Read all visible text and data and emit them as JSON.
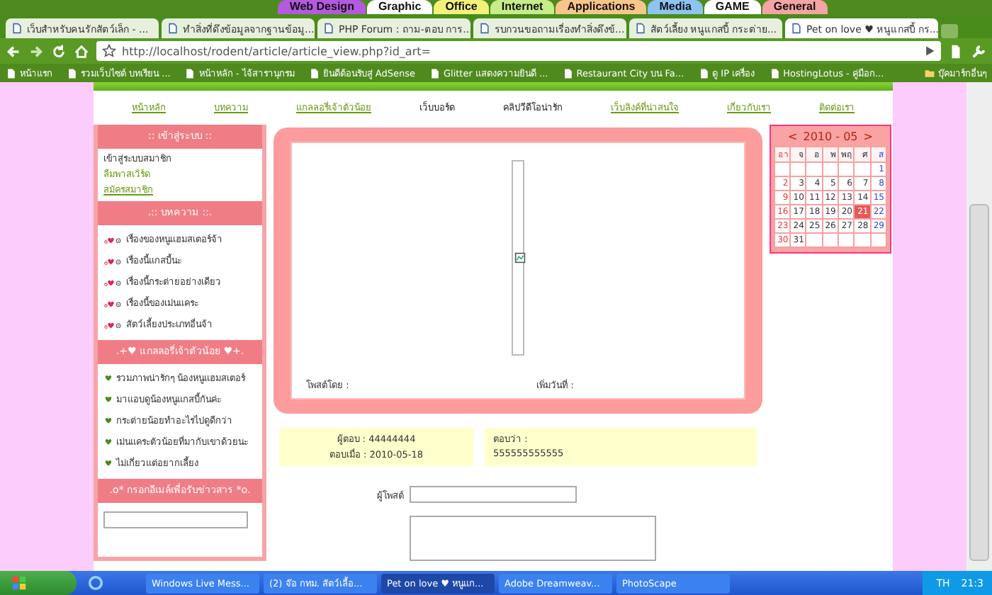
{
  "top_categories": [
    {
      "label": "Web Design",
      "color": "#b55ae0"
    },
    {
      "label": "Graphic",
      "color": "#ffffff"
    },
    {
      "label": "Office",
      "color": "#f2f27a"
    },
    {
      "label": "Internet",
      "color": "#c8ec8a"
    },
    {
      "label": "Applications",
      "color": "#f8c68a"
    },
    {
      "label": "Media",
      "color": "#8cc4f2"
    },
    {
      "label": "GAME",
      "color": "#ffffff"
    },
    {
      "label": "General",
      "color": "#f4a4a4"
    }
  ],
  "browser": {
    "tabs": [
      {
        "title": "เว็บสำหรับคนรักสัตว์เล็ก - ...",
        "selected": false
      },
      {
        "title": "ทำสิ่งที่ดึงข้อมูลจากฐานข้อมู...",
        "selected": false
      },
      {
        "title": "PHP Forum : ถาม-ตอบ การ...",
        "selected": false
      },
      {
        "title": "รบกวนขอถามเรื่องทำสิ่งดึงข้...",
        "selected": false
      },
      {
        "title": "สัตว์เลี้ยง หนูแกสบี้ กระต่าย...",
        "selected": false
      },
      {
        "title": "Pet on love ♥ หนูแกสบี้ กร...",
        "selected": true
      }
    ],
    "address": "http://localhost/rodent/article/article_view.php?id_art=",
    "bookmarks": [
      "หน้าแรก",
      "รวมเว็บไซต์ บทเรียน ...",
      "หน้าหลัก - ไจ้สารานุกรม",
      "ยินดีต้อนรับสู่ AdSense",
      "Glitter แสดงความยินดี ...",
      "Restaurant City บน Fa...",
      "ดู IP เครื่อง",
      "HostingLotus - คู่มือก..."
    ],
    "other_bookmarks": "บุ๊คมาร์กอื่นๆ"
  },
  "nav": [
    {
      "label": "หน้าหลัก",
      "underlined": true
    },
    {
      "label": "บทความ",
      "underlined": true
    },
    {
      "label": "แกลลอรี่เจ้าตัวน้อย",
      "underlined": true
    },
    {
      "label": "เว็บบอร์ด",
      "underlined": false
    },
    {
      "label": "คลิปวีดีโอน่ารัก",
      "underlined": false
    },
    {
      "label": "เว็บลิงค์ที่น่าสนใจ",
      "underlined": true
    },
    {
      "label": "เกี่ยวกับเรา",
      "underlined": true
    },
    {
      "label": "ติดต่อเรา",
      "underlined": true
    }
  ],
  "sidebar": [
    {
      "title": ":: เข้าสู่ระบบ ::",
      "kind": "login",
      "items": [
        {
          "label": "เข้าสู่ระบบสมาชิก",
          "kind": "text"
        },
        {
          "label": "ลืมพาสเวิร์ด",
          "kind": "link"
        },
        {
          "label": "สมัครสมาชิก",
          "kind": "underlined"
        }
      ]
    },
    {
      "title": ".:: บทความ ::.",
      "kind": "articles",
      "items": [
        {
          "label": "เรื่องของหนูแฮมสเตอร์จ้า",
          "kind": "text"
        },
        {
          "label": "เรื่องนี้แกสบี้นะ",
          "kind": "text"
        },
        {
          "label": "เรื่องนี้กระต่ายอย่างเดียว",
          "kind": "text"
        },
        {
          "label": "เรื่องนี้ของเม่นแคระ",
          "kind": "text"
        },
        {
          "label": "สัตว์เลี้ยงประเภทอื่นจ้า",
          "kind": "text"
        }
      ]
    },
    {
      "title": ".+♥ แกลลอรี่เจ้าตัวน้อย ♥+.",
      "kind": "gallery",
      "items": [
        {
          "label": "รวมภาพน่ารักๆ น้องหนูแฮมสเตอร์",
          "kind": "text"
        },
        {
          "label": "มาแอบดูน้องหนูแกสบี้กันค่ะ",
          "kind": "text"
        },
        {
          "label": "กระต่ายน้อยทำอะไรไปดูดีกว่า",
          "kind": "text"
        },
        {
          "label": "เม่นแคระตัวน้อยที่มากับเขาด้วยนะ",
          "kind": "text"
        },
        {
          "label": "ไม่เกี่ยวแต่อยากเลี้ยง",
          "kind": "text"
        }
      ]
    },
    {
      "title": ".o* กรอกอีเมล์เพื่อรับข่าวสาร *o.",
      "kind": "email"
    }
  ],
  "post": {
    "by_label": "โพสต์โดย :",
    "date_label": "เพิ่มวันที่ :"
  },
  "reply": {
    "author": "ผู้ตอบ : 44444444",
    "replied_at": "ตอบเมื่อ : 2010-05-18",
    "message_label": "ตอบว่า :",
    "message": "555555555555"
  },
  "form": {
    "poster_label": "ผู้โพสต์"
  },
  "calendar": {
    "prev": "<",
    "title": "2010 - 05",
    "next": ">",
    "weekdays": [
      {
        "label": "อา",
        "color": "#e03a3a"
      },
      {
        "label": "จ",
        "color": "#333333"
      },
      {
        "label": "อ",
        "color": "#333333"
      },
      {
        "label": "พ",
        "color": "#333333"
      },
      {
        "label": "พฤ",
        "color": "#333333"
      },
      {
        "label": "ศ",
        "color": "#333333"
      },
      {
        "label": "ส",
        "color": "#3344cc"
      }
    ],
    "weeks": [
      [
        {
          "kind": "blank"
        },
        {
          "kind": "blank"
        },
        {
          "kind": "blank"
        },
        {
          "kind": "blank"
        },
        {
          "kind": "blank"
        },
        {
          "kind": "blank"
        },
        {
          "kind": "day",
          "day": "1",
          "selected": false
        }
      ],
      [
        {
          "kind": "day",
          "day": "2",
          "selected": false
        },
        {
          "kind": "day",
          "day": "3",
          "selected": false
        },
        {
          "kind": "day",
          "day": "4",
          "selected": false
        },
        {
          "kind": "day",
          "day": "5",
          "selected": false
        },
        {
          "kind": "day",
          "day": "6",
          "selected": false
        },
        {
          "kind": "day",
          "day": "7",
          "selected": false
        },
        {
          "kind": "day",
          "day": "8",
          "selected": false
        }
      ],
      [
        {
          "kind": "day",
          "day": "9",
          "selected": false
        },
        {
          "kind": "day",
          "day": "10",
          "selected": false
        },
        {
          "kind": "day",
          "day": "11",
          "selected": false
        },
        {
          "kind": "day",
          "day": "12",
          "selected": false
        },
        {
          "kind": "day",
          "day": "13",
          "selected": false
        },
        {
          "kind": "day",
          "day": "14",
          "selected": false
        },
        {
          "kind": "day",
          "day": "15",
          "selected": false
        }
      ],
      [
        {
          "kind": "day",
          "day": "16",
          "selected": false
        },
        {
          "kind": "day",
          "day": "17",
          "selected": false
        },
        {
          "kind": "day",
          "day": "18",
          "selected": false
        },
        {
          "kind": "day",
          "day": "19",
          "selected": false
        },
        {
          "kind": "day",
          "day": "20",
          "selected": false
        },
        {
          "kind": "day",
          "day": "21",
          "selected": true
        },
        {
          "kind": "day",
          "day": "22",
          "selected": false
        }
      ],
      [
        {
          "kind": "day",
          "day": "23",
          "selected": false
        },
        {
          "kind": "day",
          "day": "24",
          "selected": false
        },
        {
          "kind": "day",
          "day": "25",
          "selected": false
        },
        {
          "kind": "day",
          "day": "26",
          "selected": false
        },
        {
          "kind": "day",
          "day": "27",
          "selected": false
        },
        {
          "kind": "day",
          "day": "28",
          "selected": false
        },
        {
          "kind": "day",
          "day": "29",
          "selected": false
        }
      ],
      [
        {
          "kind": "day",
          "day": "30",
          "selected": false
        },
        {
          "kind": "day",
          "day": "31",
          "selected": false
        },
        {
          "kind": "blank"
        },
        {
          "kind": "blank"
        },
        {
          "kind": "blank"
        },
        {
          "kind": "blank"
        },
        {
          "kind": "blank"
        }
      ]
    ]
  },
  "taskbar": {
    "items": [
      {
        "label": "Windows Live Mess...",
        "selected": false
      },
      {
        "label": "(2) จ๊อ กทม. สัตว์เลื้อ...",
        "selected": false
      },
      {
        "label": "Pet on love ♥ หนูแก...",
        "selected": true
      },
      {
        "label": "Adobe Dreamweav...",
        "selected": false
      },
      {
        "label": "PhotoScape",
        "selected": false
      }
    ],
    "language": "TH",
    "clock": "21:3"
  }
}
